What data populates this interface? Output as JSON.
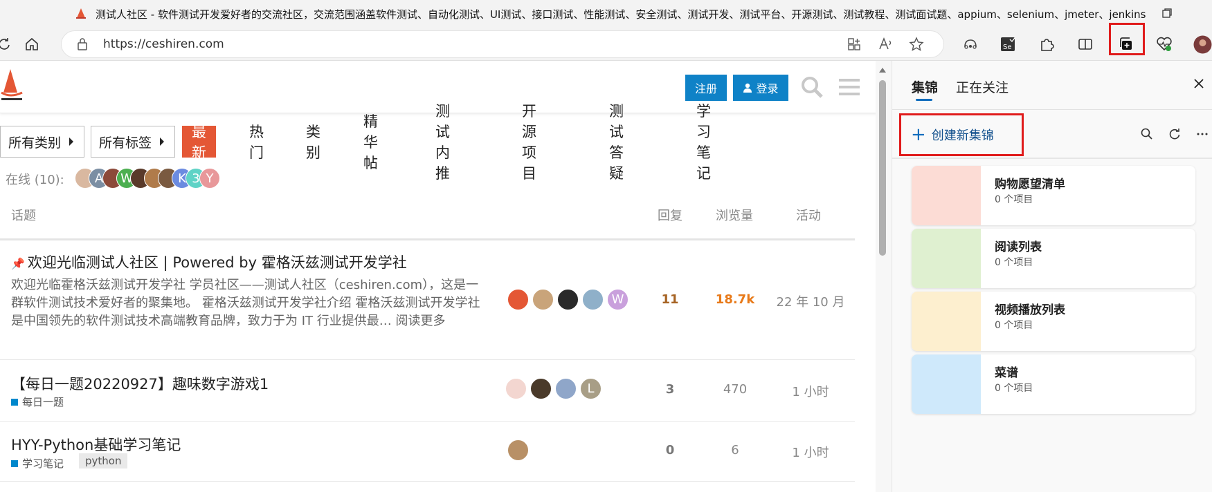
{
  "window": {
    "title": "测试人社区 - 软件测试开发爱好者的交流社区，交流范围涵盖软件测试、自动化测试、UI测试、接口测试、性能测试、安全测试、测试开发、测试平台、开源测试、测试教程、测试面试题、appium、selenium、jmeter、jenkins"
  },
  "addressbar": {
    "url": "https://ceshiren.com"
  },
  "site": {
    "register_label": "注册",
    "login_label": "登录",
    "nav": {
      "all_categories": "所有类别",
      "all_tags": "所有标签",
      "tabs": [
        "最新",
        "热门",
        "类别",
        "精华帖",
        "测试内推",
        "开源项目",
        "测试答疑",
        "学习笔记"
      ],
      "active_tab": "最新"
    },
    "online_label": "在线 (10):",
    "online_avatars": [
      {
        "letter": "",
        "color": "#d9b8a0"
      },
      {
        "letter": "A",
        "color": "#7b8ea3"
      },
      {
        "letter": "",
        "color": "#8c4a3a"
      },
      {
        "letter": "W",
        "color": "#4caf50"
      },
      {
        "letter": "",
        "color": "#5a3a2a"
      },
      {
        "letter": "",
        "color": "#b07b4a"
      },
      {
        "letter": "",
        "color": "#7a5a40"
      },
      {
        "letter": "K",
        "color": "#6b8be0"
      },
      {
        "letter": "3",
        "color": "#5fd3c6"
      },
      {
        "letter": "Y",
        "color": "#e8989a"
      }
    ],
    "columns": {
      "topic": "话题",
      "replies": "回复",
      "views": "浏览量",
      "activity": "活动"
    },
    "topics": [
      {
        "title": "欢迎光临测试人社区 | Powered by 霍格沃兹测试开发学社",
        "excerpt": "欢迎光临霍格沃兹测试开发学社 学员社区——测试人社区（ceshiren.com），这是一群软件测试技术爱好者的聚集地。 霍格沃兹测试开发学社介绍 霍格沃兹测试开发学社是中国领先的软件测试技术高端教育品牌，致力于为 IT 行业提供最… 阅读更多",
        "replies": "11",
        "views": "18.7k",
        "activity": "22 年 10 月",
        "posters": [
          {
            "letter": "",
            "color": "#e45735"
          },
          {
            "letter": "",
            "color": "#c9a47a"
          },
          {
            "letter": "",
            "color": "#2a2a2a"
          },
          {
            "letter": "",
            "color": "#8fb0c9"
          },
          {
            "letter": "W",
            "color": "#c9a0dc"
          }
        ]
      },
      {
        "title": "【每日一题20220927】趣味数字游戏1",
        "category": "每日一题",
        "replies": "3",
        "views": "470",
        "activity": "1 小时",
        "posters": [
          {
            "letter": "",
            "color": "#f3d6d0"
          },
          {
            "letter": "",
            "color": "#4a3a2a"
          },
          {
            "letter": "",
            "color": "#8fa6c9"
          },
          {
            "letter": "L",
            "color": "#a89e86"
          }
        ]
      },
      {
        "title": "HYY-Python基础学习笔记",
        "category": "学习笔记",
        "tag": "python",
        "replies": "0",
        "views": "6",
        "activity": "1 小时",
        "posters": [
          {
            "letter": "",
            "color": "#b89066"
          }
        ]
      }
    ]
  },
  "collections_panel": {
    "tabs": [
      "集锦",
      "正在关注"
    ],
    "create_label": "创建新集锦",
    "cards": [
      {
        "title": "购物愿望清单",
        "count": "0 个项目",
        "color": "#fcdcd5"
      },
      {
        "title": "阅读列表",
        "count": "0 个项目",
        "color": "#dff0d0"
      },
      {
        "title": "视频播放列表",
        "count": "0 个项目",
        "color": "#fdefcf"
      },
      {
        "title": "菜谱",
        "count": "0 个项目",
        "color": "#cfe9fb"
      }
    ]
  }
}
